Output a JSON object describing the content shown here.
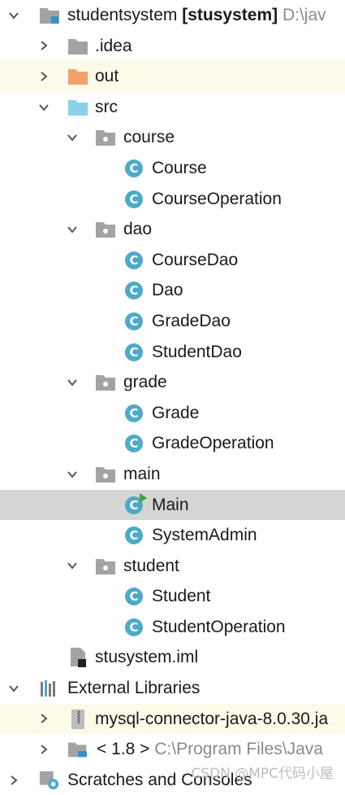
{
  "tree": {
    "project": {
      "name": "studentsystem",
      "module": "[stusystem]",
      "path": "D:\\jav"
    },
    "idea": ".idea",
    "out": "out",
    "src": "src",
    "packages": {
      "course": {
        "label": "course",
        "classes": [
          "Course",
          "CourseOperation"
        ]
      },
      "dao": {
        "label": "dao",
        "classes": [
          "CourseDao",
          "Dao",
          "GradeDao",
          "StudentDao"
        ]
      },
      "grade": {
        "label": "grade",
        "classes": [
          "Grade",
          "GradeOperation"
        ]
      },
      "main": {
        "label": "main",
        "classes": [
          "Main",
          "SystemAdmin"
        ]
      },
      "student": {
        "label": "student",
        "classes": [
          "Student",
          "StudentOperation"
        ]
      }
    },
    "iml": "stusystem.iml",
    "external_libraries": "External Libraries",
    "mysql": "mysql-connector-java-8.0.30.ja",
    "jdk": {
      "label": "< 1.8 >",
      "path": "C:\\Program Files\\Java"
    },
    "scratches": "Scratches and Consoles"
  },
  "class_icon_letter": "C",
  "watermark": "CSDN @MPC代码小屋",
  "colors": {
    "folder_gray": "#a3a3a3",
    "folder_orange": "#f4a06b",
    "folder_blue": "#8ad0ec",
    "class_icon": "#4dabc8",
    "run_marker": "#3fa33f",
    "selected_row": "#d5d5d5",
    "highlight_row": "#fcfbe9"
  }
}
